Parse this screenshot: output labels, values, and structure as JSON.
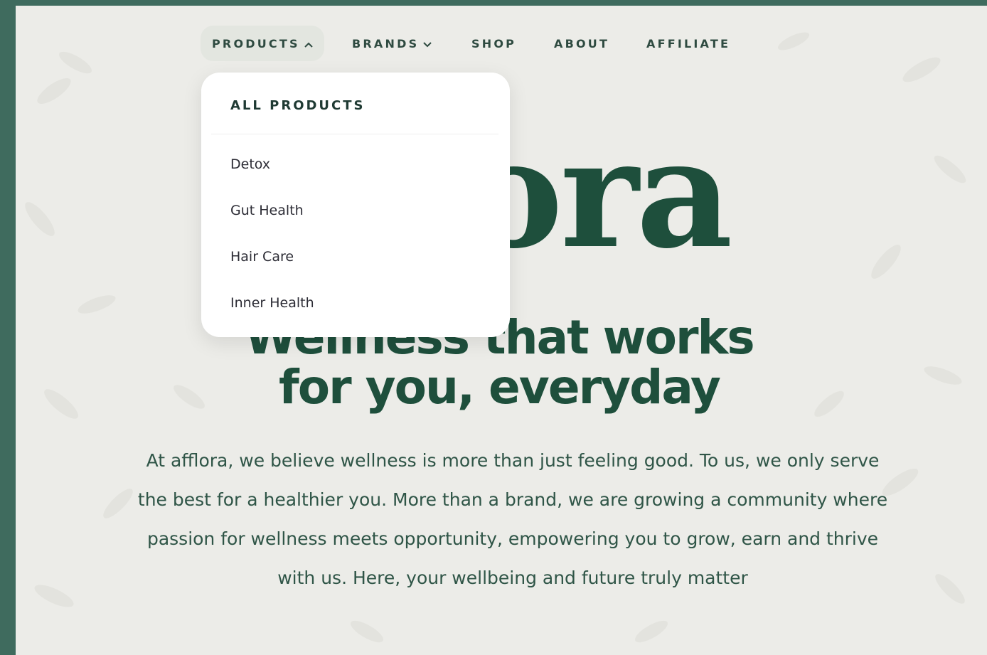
{
  "nav": {
    "items": [
      {
        "label": "PRODUCTS",
        "has_menu": true,
        "open": true
      },
      {
        "label": "BRANDS",
        "has_menu": true,
        "open": false
      },
      {
        "label": "SHOP"
      },
      {
        "label": "ABOUT"
      },
      {
        "label": "AFFILIATE"
      }
    ]
  },
  "dropdown": {
    "heading": "ALL PRODUCTS",
    "items": [
      "Detox",
      "Gut Health",
      "Hair Care",
      "Inner Health"
    ]
  },
  "hero": {
    "wordmark_visible": "lora",
    "headline_line1": "Wellness that works",
    "headline_line2": "for you, everyday",
    "paragraph": "At afflora, we believe wellness is more than just feeling good. To us, we only serve the best for a healthier you. More than a brand, we are growing a community where passion for wellness meets opportunity, empowering you to grow, earn and thrive with us. Here, your wellbeing and future truly matter"
  },
  "colors": {
    "brand_green": "#1e4f3c",
    "frame_green": "#3f6b5e",
    "background": "#ecece8",
    "menu_bg": "#ffffff"
  },
  "icons": {
    "chevron_up": "chevron-up-icon",
    "chevron_down": "chevron-down-icon",
    "background_pattern": "leaf-pattern"
  }
}
